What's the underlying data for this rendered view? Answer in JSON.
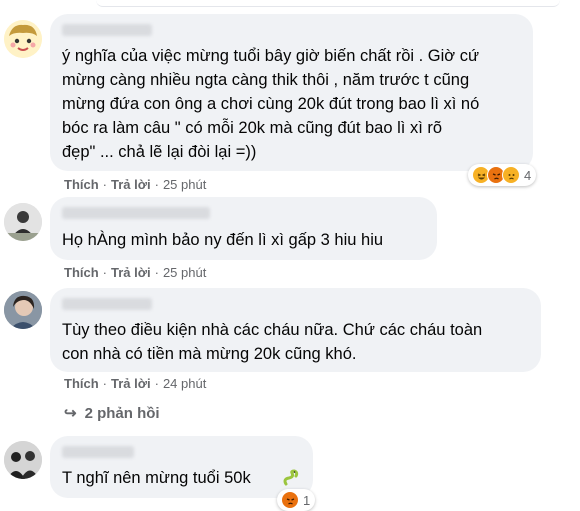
{
  "comments": [
    {
      "text": "ý nghĩa của việc mừng tuổi bây giờ biến chất rồi . Giờ cứ\nmừng càng nhiều ngta càng thik thôi , năm trước t cũng\nmừng đứa con ông a chơi cùng 20k đút trong bao lì xì nó\nbóc ra làm câu \" có mỗi 20k mà cũng đút bao lì xì rõ\nđẹp\" ... chả lẽ lại đòi lại =))",
      "like": "Thích",
      "reply": "Trả lời",
      "time": "25 phút",
      "reaction_count": "4"
    },
    {
      "text": "Họ hÀng mình bảo ny đến lì xì gấp 3 hiu hiu",
      "like": "Thích",
      "reply": "Trả lời",
      "time": "25 phút"
    },
    {
      "text": "Tùy theo điều kiện nhà các cháu nữa. Chứ các cháu toàn\ncon nhà có tiền mà mừng 20k cũng khó.",
      "like": "Thích",
      "reply": "Trả lời",
      "time": "24 phút",
      "replies_label": "2 phản hồi"
    },
    {
      "text": "T nghĩ nên mừng tuổi 50k",
      "reaction_count": "1"
    }
  ],
  "separator": "·",
  "icons": {
    "reply_arrow": "↪",
    "reactions_c1": [
      "haha",
      "angry",
      "sad"
    ],
    "reactions_c4": [
      "angry"
    ],
    "emoji_after_c4": "snake"
  },
  "colors": {
    "bubble": "#f0f2f5",
    "meta_text": "#65676b",
    "angry": "#e9710f",
    "haha": "#f7b125"
  }
}
